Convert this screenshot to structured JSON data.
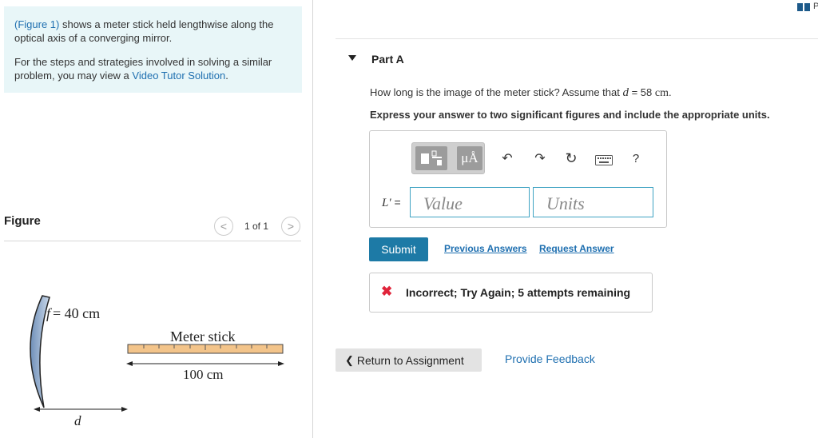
{
  "info": {
    "fig_ref": "(Figure 1)",
    "line1_rest": " shows a meter stick held lengthwise along the optical axis of a converging mirror.",
    "line2_pre": "For the steps and strategies involved in solving a similar problem, you may view a ",
    "video_link": "Video Tutor Solution",
    "line2_post": "."
  },
  "figure": {
    "label": "Figure",
    "pager": "1 of 1",
    "prev_glyph": "<",
    "next_glyph": ">",
    "focal_label": "f = 40 cm",
    "focal_var": "f",
    "focal_rest": "= 40 cm",
    "stick_label": "Meter stick",
    "length_label": "100 cm",
    "distance_label": "d"
  },
  "part": {
    "title": "Part A",
    "question_pre": "How long is the image of the meter stick? Assume that ",
    "question_var": "d",
    "question_eq": " = 58 ",
    "question_unit": "cm",
    "question_post": ".",
    "instruction": "Express your answer to two significant figures and include the appropriate units."
  },
  "toolbar": {
    "units_glyph": "μÅ",
    "undo_icon": "↶",
    "redo_icon": "↷",
    "reset_icon": "↻",
    "keyboard_icon": "keyboard",
    "help": "?"
  },
  "answer": {
    "var_label": "L′",
    "equals": " =",
    "value_placeholder": "Value",
    "units_placeholder": "Units"
  },
  "actions": {
    "submit": "Submit",
    "previous_answers": "Previous Answers",
    "request_answer": "Request Answer"
  },
  "feedback": {
    "icon": "✖",
    "message": "Incorrect; Try Again; 5 attempts remaining"
  },
  "footer": {
    "return_chevron": "❮",
    "return_label": "Return to Assignment",
    "provide_feedback": "Provide Feedback"
  },
  "corner": {
    "text": "P"
  },
  "colors": {
    "accent": "#1d7aa6",
    "link": "#1e6fb0",
    "error": "#e0243a",
    "info_bg": "#e8f6f8"
  }
}
